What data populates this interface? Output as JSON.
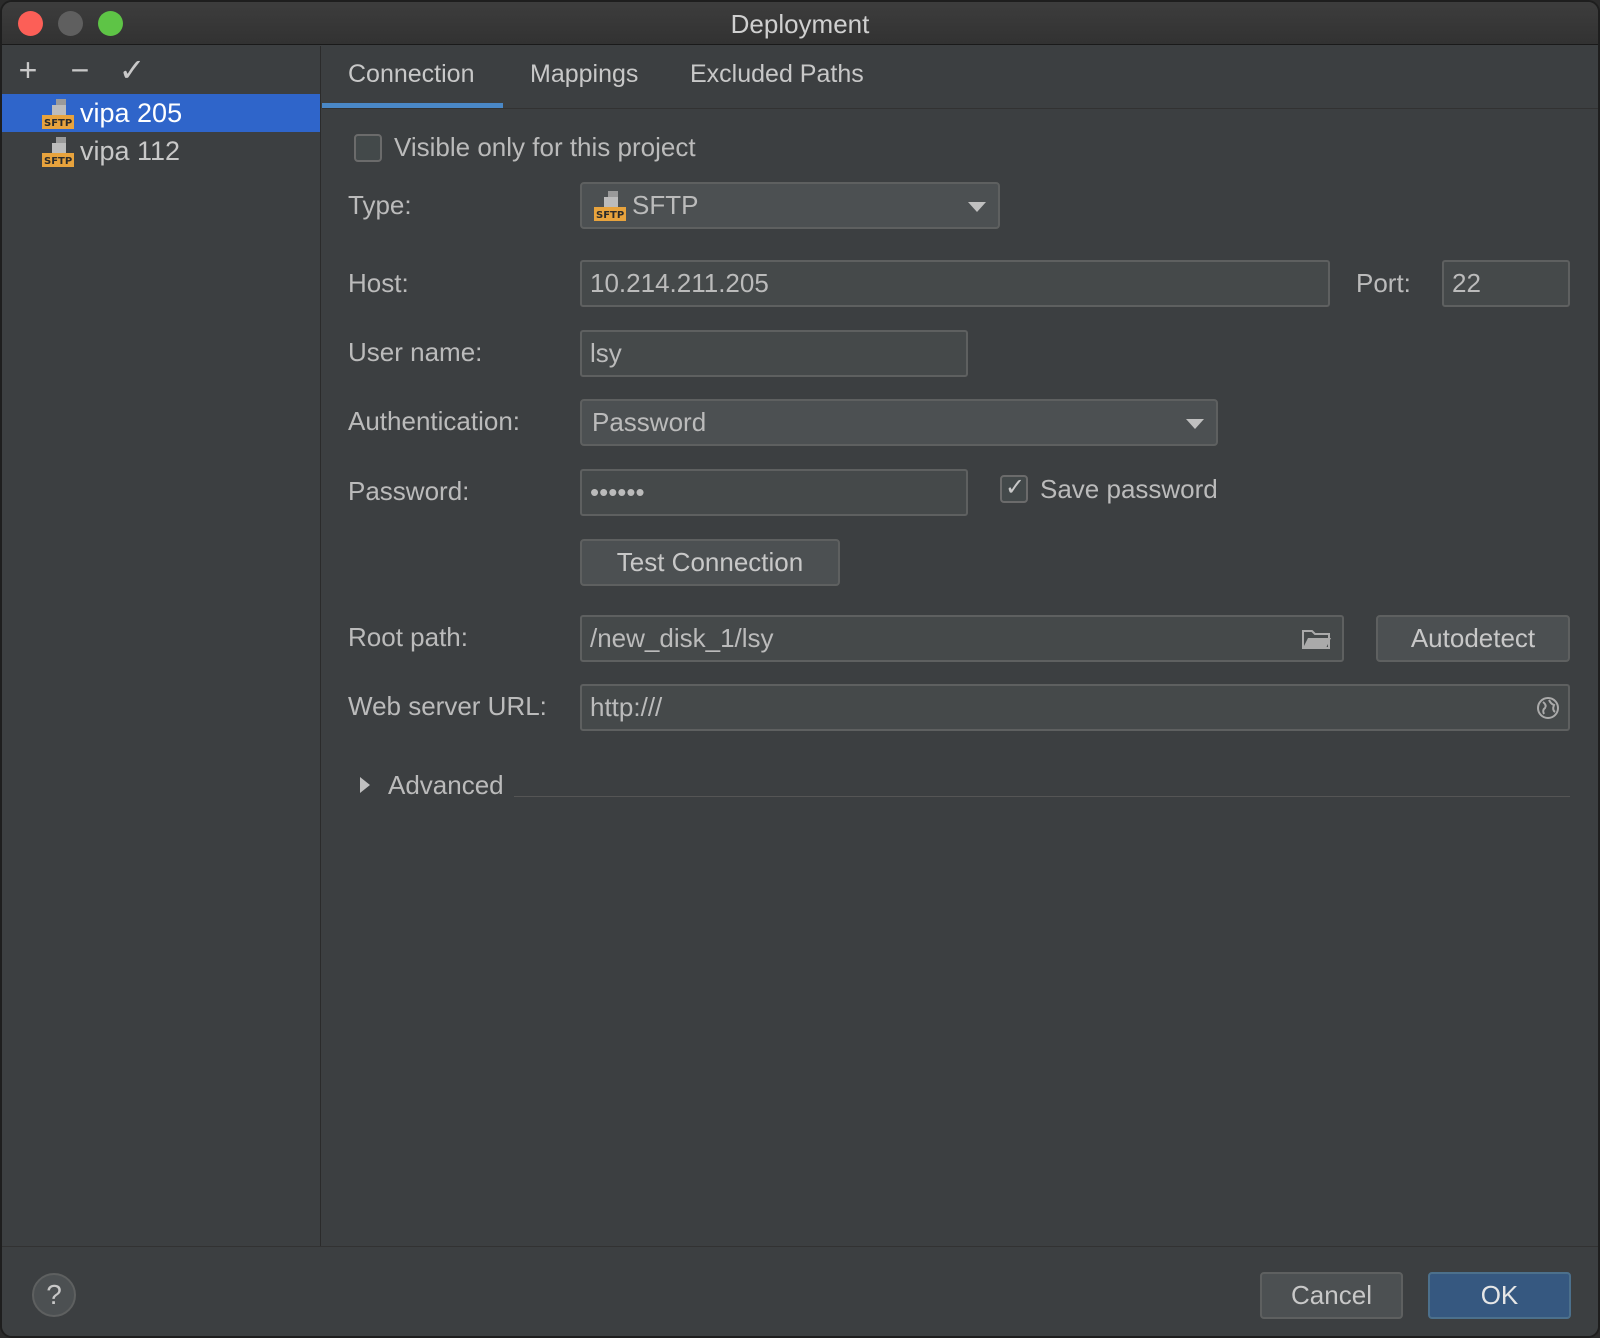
{
  "window": {
    "title": "Deployment"
  },
  "toolbar": {
    "add": "+",
    "remove": "−",
    "confirm": "✓"
  },
  "servers": [
    {
      "name": "vipa 205",
      "icon": "sftp-server-icon",
      "selected": true
    },
    {
      "name": "vipa 112",
      "icon": "sftp-server-icon",
      "selected": false
    }
  ],
  "tabs": [
    {
      "label": "Connection",
      "active": true
    },
    {
      "label": "Mappings",
      "active": false
    },
    {
      "label": "Excluded Paths",
      "active": false
    }
  ],
  "form": {
    "visible_only": {
      "label": "Visible only for this project",
      "checked": false
    },
    "type": {
      "label": "Type:",
      "value": "SFTP"
    },
    "host": {
      "label": "Host:",
      "value": "10.214.211.205"
    },
    "port": {
      "label": "Port:",
      "value": "22"
    },
    "username": {
      "label": "User name:",
      "value": "lsy"
    },
    "auth": {
      "label": "Authentication:",
      "value": "Password"
    },
    "password": {
      "label": "Password:",
      "value": "••••••"
    },
    "save_password": {
      "label": "Save password",
      "checked": true
    },
    "test_connection": "Test Connection",
    "root_path": {
      "label": "Root path:",
      "value": "/new_disk_1/lsy"
    },
    "autodetect": "Autodetect",
    "web_url": {
      "label": "Web server URL:",
      "value": "http:///"
    },
    "advanced": "Advanced"
  },
  "footer": {
    "help": "?",
    "cancel": "Cancel",
    "ok": "OK"
  },
  "colors": {
    "accent": "#2f65ca",
    "tab_underline": "#4a88c7",
    "ok_button": "#365880",
    "sftp_badge": "#e8a33d"
  }
}
